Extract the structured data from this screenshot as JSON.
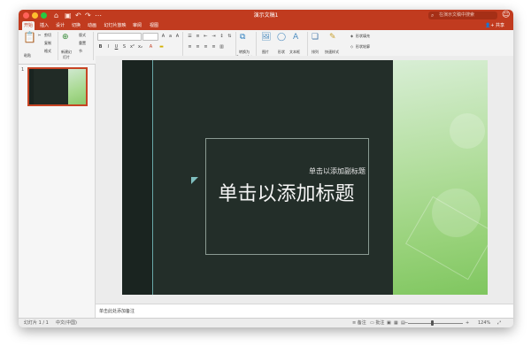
{
  "window": {
    "title": "演示文稿1",
    "search_placeholder": "在演示文稿中搜索"
  },
  "tabs": [
    "开始",
    "插入",
    "设计",
    "切换",
    "动画",
    "幻灯片放映",
    "审阅",
    "视图"
  ],
  "share_label": "共享",
  "ribbon": {
    "paste": "粘贴",
    "cut": "剪切",
    "copy": "复制",
    "format": "格式",
    "new_slide": "新建幻灯片",
    "layout": "版式",
    "reset": "重置",
    "section": "节",
    "convert_smartart": "转换为 SmartArt",
    "picture": "图片",
    "shape": "形状",
    "textbox": "文本框",
    "arrange": "排列",
    "quick_styles": "快速样式",
    "shape_fill": "形状填充",
    "shape_outline": "形状轮廓"
  },
  "thumbnail": {
    "number": "1"
  },
  "slide": {
    "subtitle": "单击以添加副标题",
    "title": "单击以添加标题"
  },
  "notes_placeholder": "单击此处添加备注",
  "status": {
    "slide_info": "幻灯片 1 / 1",
    "language": "中文(中国)",
    "notes": "备注",
    "comments": "批注",
    "zoom": "124%"
  },
  "colors": {
    "accent": "#c13b1f",
    "slide_dark": "#232e29",
    "slide_green": "#98d27a"
  }
}
